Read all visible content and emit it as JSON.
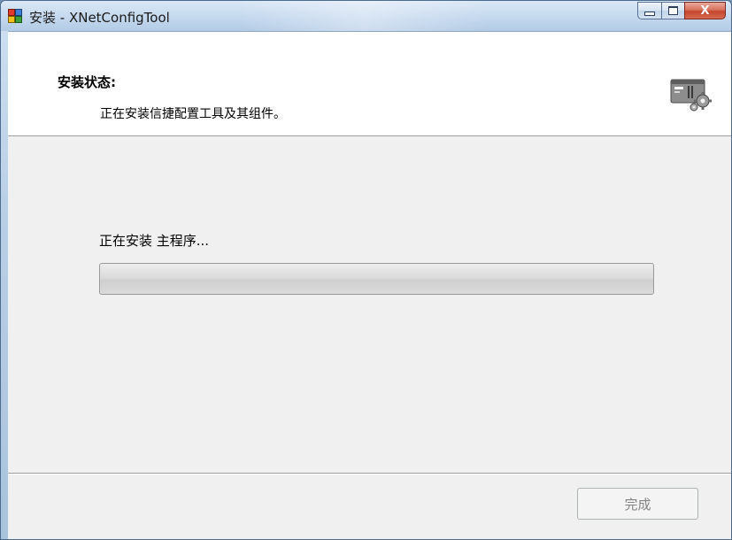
{
  "window": {
    "title": "安装 - XNetConfigTool",
    "app_icon": "installer-icon",
    "caption_buttons": {
      "minimize_icon": "minimize-icon",
      "maximize_icon": "maximize-icon",
      "close_label": "X"
    }
  },
  "header": {
    "title": "安装状态:",
    "subtitle": "正在安装信捷配置工具及其组件。",
    "icon": "device-gear-icon"
  },
  "progress": {
    "label": "正在安装 主程序...",
    "value": 0.0
  },
  "footer": {
    "finish_label": "完成",
    "finish_enabled": false
  },
  "colors": {
    "dialog_background": "#f0f0f0",
    "header_background": "#ffffff",
    "disabled_text": "#838383",
    "close_button": "#c4452c"
  }
}
